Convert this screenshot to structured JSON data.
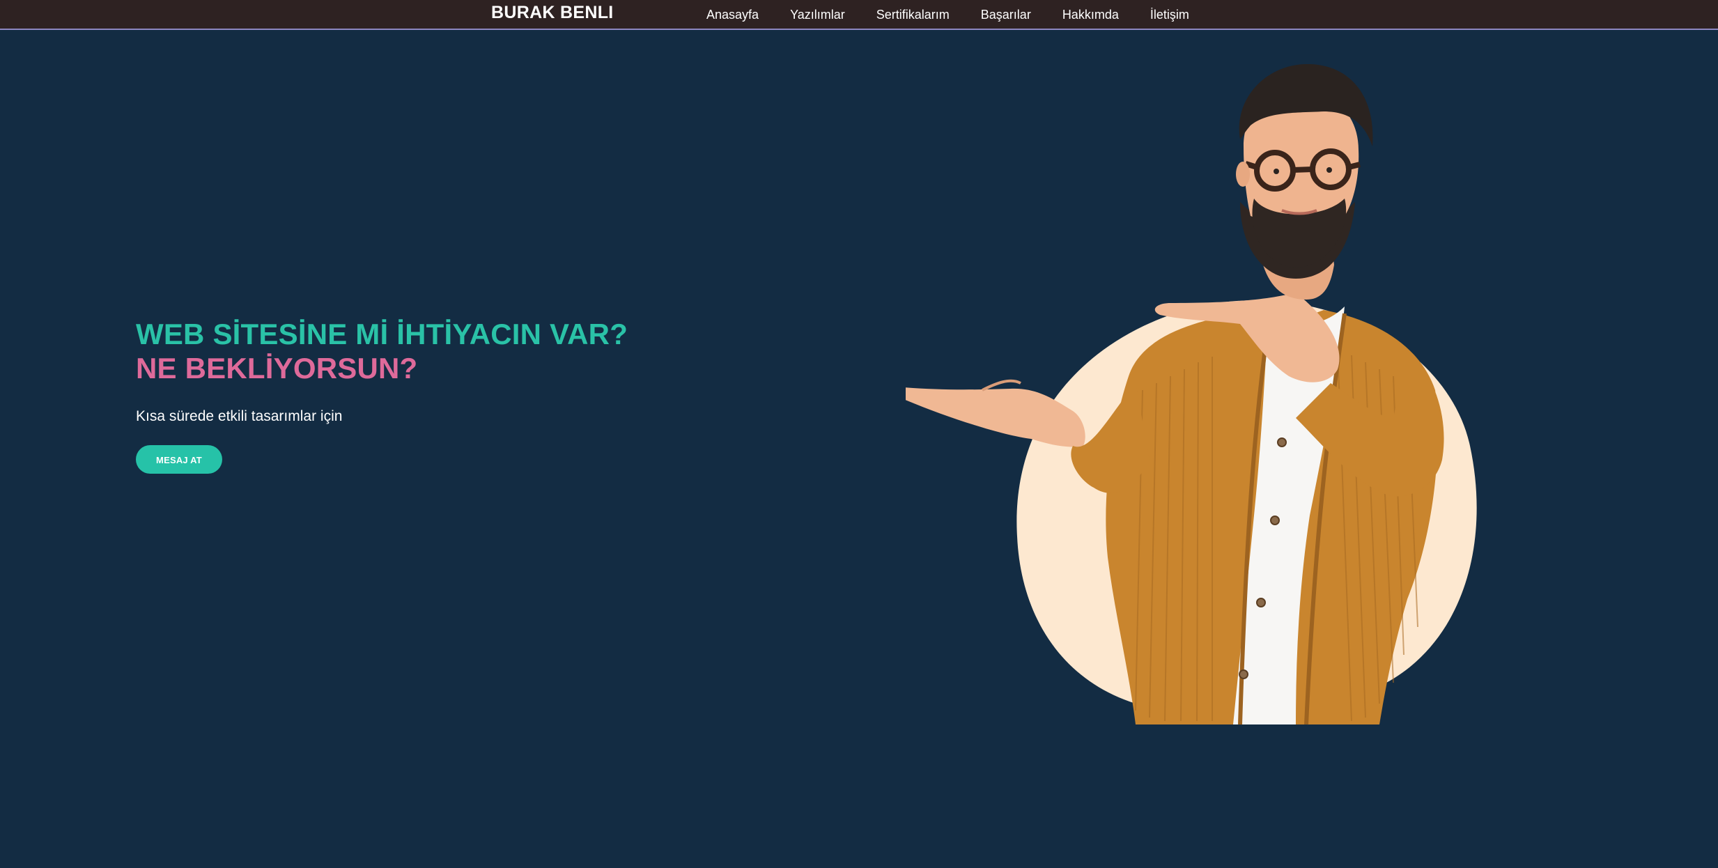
{
  "header": {
    "brand": "BURAK BENLI",
    "nav": [
      {
        "label": "Anasayfa"
      },
      {
        "label": "Yazılımlar"
      },
      {
        "label": "Sertifikalarım"
      },
      {
        "label": "Başarılar"
      },
      {
        "label": "Hakkımda"
      },
      {
        "label": "İletişim"
      }
    ]
  },
  "hero": {
    "headline_line1": "WEB SİTESİNE Mİ İHTİYACIN VAR?",
    "headline_line2": "NE BEKLİYORSUN?",
    "subtitle": "Kısa sürede etkili tasarımlar için",
    "cta_label": "MESAJ AT"
  },
  "colors": {
    "page_bg": "#132c43",
    "topbar_bg": "#2e2222",
    "accent_teal": "#2ac2a7",
    "accent_pink": "#de6a9a",
    "blob": "#fde8d0",
    "jacket": "#c9852e"
  }
}
